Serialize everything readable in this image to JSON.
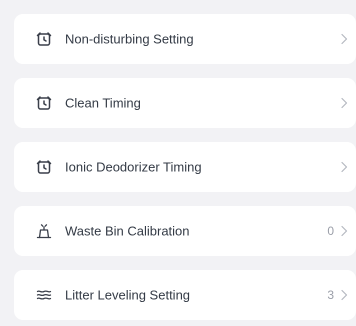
{
  "settings": {
    "items": [
      {
        "label": "Non-disturbing Setting",
        "value": "",
        "icon": "alarm-clock-icon"
      },
      {
        "label": "Clean Timing",
        "value": "",
        "icon": "alarm-clock-icon"
      },
      {
        "label": "Ionic Deodorizer Timing",
        "value": "",
        "icon": "alarm-clock-icon"
      },
      {
        "label": "Waste Bin Calibration",
        "value": "0",
        "icon": "bin-icon"
      },
      {
        "label": "Litter Leveling Setting",
        "value": "3",
        "icon": "wave-lines-icon"
      }
    ]
  },
  "colors": {
    "background": "#f2f2f5",
    "card": "#ffffff",
    "text": "#333a45",
    "muted": "#9a9ea8"
  }
}
